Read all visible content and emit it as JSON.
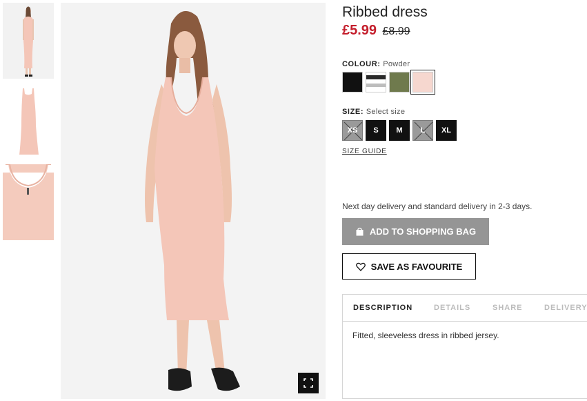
{
  "product": {
    "title": "Ribbed dress",
    "price_sale": "£5.99",
    "price_original": "£8.99"
  },
  "colour": {
    "label": "COLOUR:",
    "selected": "Powder",
    "swatches": [
      {
        "name": "Black",
        "color": "#111111"
      },
      {
        "name": "Black/White striped",
        "color": "#cccccc"
      },
      {
        "name": "Khaki green",
        "color": "#6f7a4d"
      },
      {
        "name": "Powder",
        "color": "#f6d7cf"
      }
    ]
  },
  "size": {
    "label": "SIZE:",
    "prompt": "Select size",
    "options": [
      {
        "label": "XS",
        "available": false
      },
      {
        "label": "S",
        "available": true
      },
      {
        "label": "M",
        "available": true
      },
      {
        "label": "L",
        "available": false
      },
      {
        "label": "XL",
        "available": true
      }
    ],
    "guide_link": "SIZE GUIDE"
  },
  "delivery_text": "Next day delivery and standard delivery in 2-3 days.",
  "buttons": {
    "add_to_bag": "ADD TO SHOPPING BAG",
    "save_favourite": "SAVE AS FAVOURITE"
  },
  "tabs": {
    "items": [
      "DESCRIPTION",
      "DETAILS",
      "SHARE",
      "DELIVERY"
    ],
    "active": "DESCRIPTION",
    "description_text": "Fitted, sleeveless dress in ribbed jersey."
  },
  "colors": {
    "sale_red": "#c41e2c",
    "bag_button": "#959595",
    "dress_pink": "#f4c6b8"
  },
  "icons": {
    "bag": "shopping-bag-icon",
    "heart": "heart-icon",
    "expand": "expand-icon"
  }
}
